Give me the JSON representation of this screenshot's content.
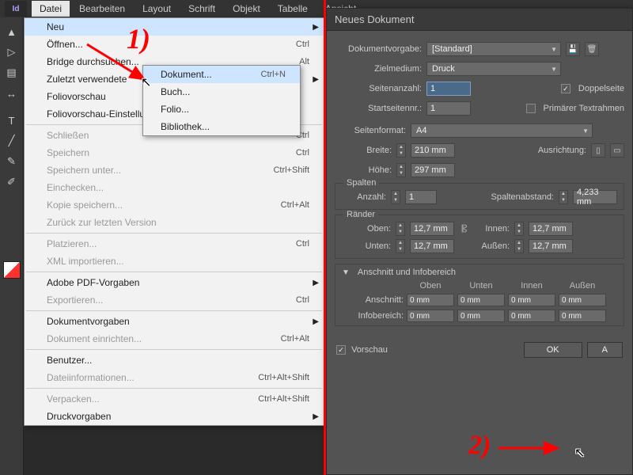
{
  "menubar": [
    "Datei",
    "Bearbeiten",
    "Layout",
    "Schrift",
    "Objekt",
    "Tabelle",
    "Ansicht"
  ],
  "active_menu": 0,
  "file_menu": [
    {
      "label": "Neu",
      "type": "submenu",
      "active": true
    },
    {
      "label": "Öffnen...",
      "shortcut": "Ctrl"
    },
    {
      "label": "Bridge durchsuchen...",
      "shortcut": "Alt"
    },
    {
      "label": "Zuletzt verwendete",
      "type": "submenu"
    },
    {
      "label": "Foliovorschau"
    },
    {
      "label": "Foliovorschau-Einstellungen..."
    },
    {
      "type": "sep"
    },
    {
      "label": "Schließen",
      "shortcut": "Ctrl",
      "disabled": true
    },
    {
      "label": "Speichern",
      "shortcut": "Ctrl",
      "disabled": true
    },
    {
      "label": "Speichern unter...",
      "shortcut": "Ctrl+Shift",
      "disabled": true
    },
    {
      "label": "Einchecken...",
      "disabled": true
    },
    {
      "label": "Kopie speichern...",
      "shortcut": "Ctrl+Alt",
      "disabled": true
    },
    {
      "label": "Zurück zur letzten Version",
      "disabled": true
    },
    {
      "type": "sep"
    },
    {
      "label": "Platzieren...",
      "shortcut": "Ctrl",
      "disabled": true
    },
    {
      "label": "XML importieren...",
      "disabled": true
    },
    {
      "type": "sep"
    },
    {
      "label": "Adobe PDF-Vorgaben",
      "type": "submenu"
    },
    {
      "label": "Exportieren...",
      "shortcut": "Ctrl",
      "disabled": true
    },
    {
      "type": "sep"
    },
    {
      "label": "Dokumentvorgaben",
      "type": "submenu"
    },
    {
      "label": "Dokument einrichten...",
      "shortcut": "Ctrl+Alt",
      "disabled": true
    },
    {
      "type": "sep"
    },
    {
      "label": "Benutzer..."
    },
    {
      "label": "Dateiinformationen...",
      "shortcut": "Ctrl+Alt+Shift",
      "disabled": true
    },
    {
      "type": "sep"
    },
    {
      "label": "Verpacken...",
      "shortcut": "Ctrl+Alt+Shift",
      "disabled": true
    },
    {
      "label": "Druckvorgaben",
      "type": "submenu"
    }
  ],
  "submenu_neu": [
    {
      "label": "Dokument...",
      "shortcut": "Ctrl+N",
      "hover": true
    },
    {
      "label": "Buch..."
    },
    {
      "label": "Folio..."
    },
    {
      "label": "Bibliothek..."
    }
  ],
  "dialog": {
    "title": "Neues Dokument",
    "preset_label": "Dokumentvorgabe:",
    "preset_value": "[Standard]",
    "intent_label": "Zielmedium:",
    "intent_value": "Druck",
    "pages_label": "Seitenanzahl:",
    "pages_value": "1",
    "facing_label": "Doppelseite",
    "facing_checked": true,
    "startpage_label": "Startseitennr.:",
    "startpage_value": "1",
    "primary_label": "Primärer Textrahmen",
    "primary_checked": false,
    "pageformat_label": "Seitenformat:",
    "pageformat_value": "A4",
    "width_label": "Breite:",
    "width_value": "210 mm",
    "height_label": "Höhe:",
    "height_value": "297 mm",
    "orientation_label": "Ausrichtung:",
    "columns_title": "Spalten",
    "columns_count_label": "Anzahl:",
    "columns_count_value": "1",
    "columns_gutter_label": "Spaltenabstand:",
    "columns_gutter_value": "4,233 mm",
    "margins_title": "Ränder",
    "margin_top_label": "Oben:",
    "margin_top_value": "12,7 mm",
    "margin_bottom_label": "Unten:",
    "margin_bottom_value": "12,7 mm",
    "margin_inner_label": "Innen:",
    "margin_inner_value": "12,7 mm",
    "margin_outer_label": "Außen:",
    "margin_outer_value": "12,7 mm",
    "bleed_title": "Anschnitt und Infobereich",
    "bleed_hdr": [
      "Oben",
      "Unten",
      "Innen",
      "Außen"
    ],
    "bleed_label": "Anschnitt:",
    "bleed_values": [
      "0 mm",
      "0 mm",
      "0 mm",
      "0 mm"
    ],
    "slug_label": "Infobereich:",
    "slug_values": [
      "0 mm",
      "0 mm",
      "0 mm",
      "0 mm"
    ],
    "preview_label": "Vorschau",
    "ok": "OK",
    "cancel": "A"
  },
  "annotations": {
    "a1": "1)",
    "a2": "2)"
  }
}
